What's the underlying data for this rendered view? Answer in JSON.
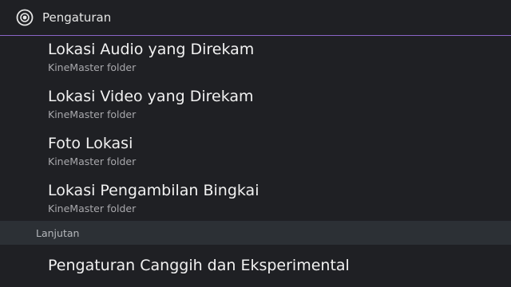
{
  "header": {
    "title": "Pengaturan",
    "icon": "settings-circle-icon",
    "accent_color": "#8a64c6"
  },
  "settings": {
    "items": [
      {
        "title": "Lokasi Audio yang Direkam",
        "subtitle": "KineMaster folder"
      },
      {
        "title": "Lokasi Video yang Direkam",
        "subtitle": "KineMaster folder"
      },
      {
        "title": "Foto Lokasi",
        "subtitle": "KineMaster folder"
      },
      {
        "title": "Lokasi Pengambilan Bingkai",
        "subtitle": "KineMaster folder"
      }
    ]
  },
  "advanced": {
    "section_label": "Lanjutan",
    "items": [
      {
        "title": "Pengaturan Canggih dan Eksperimental"
      }
    ]
  }
}
